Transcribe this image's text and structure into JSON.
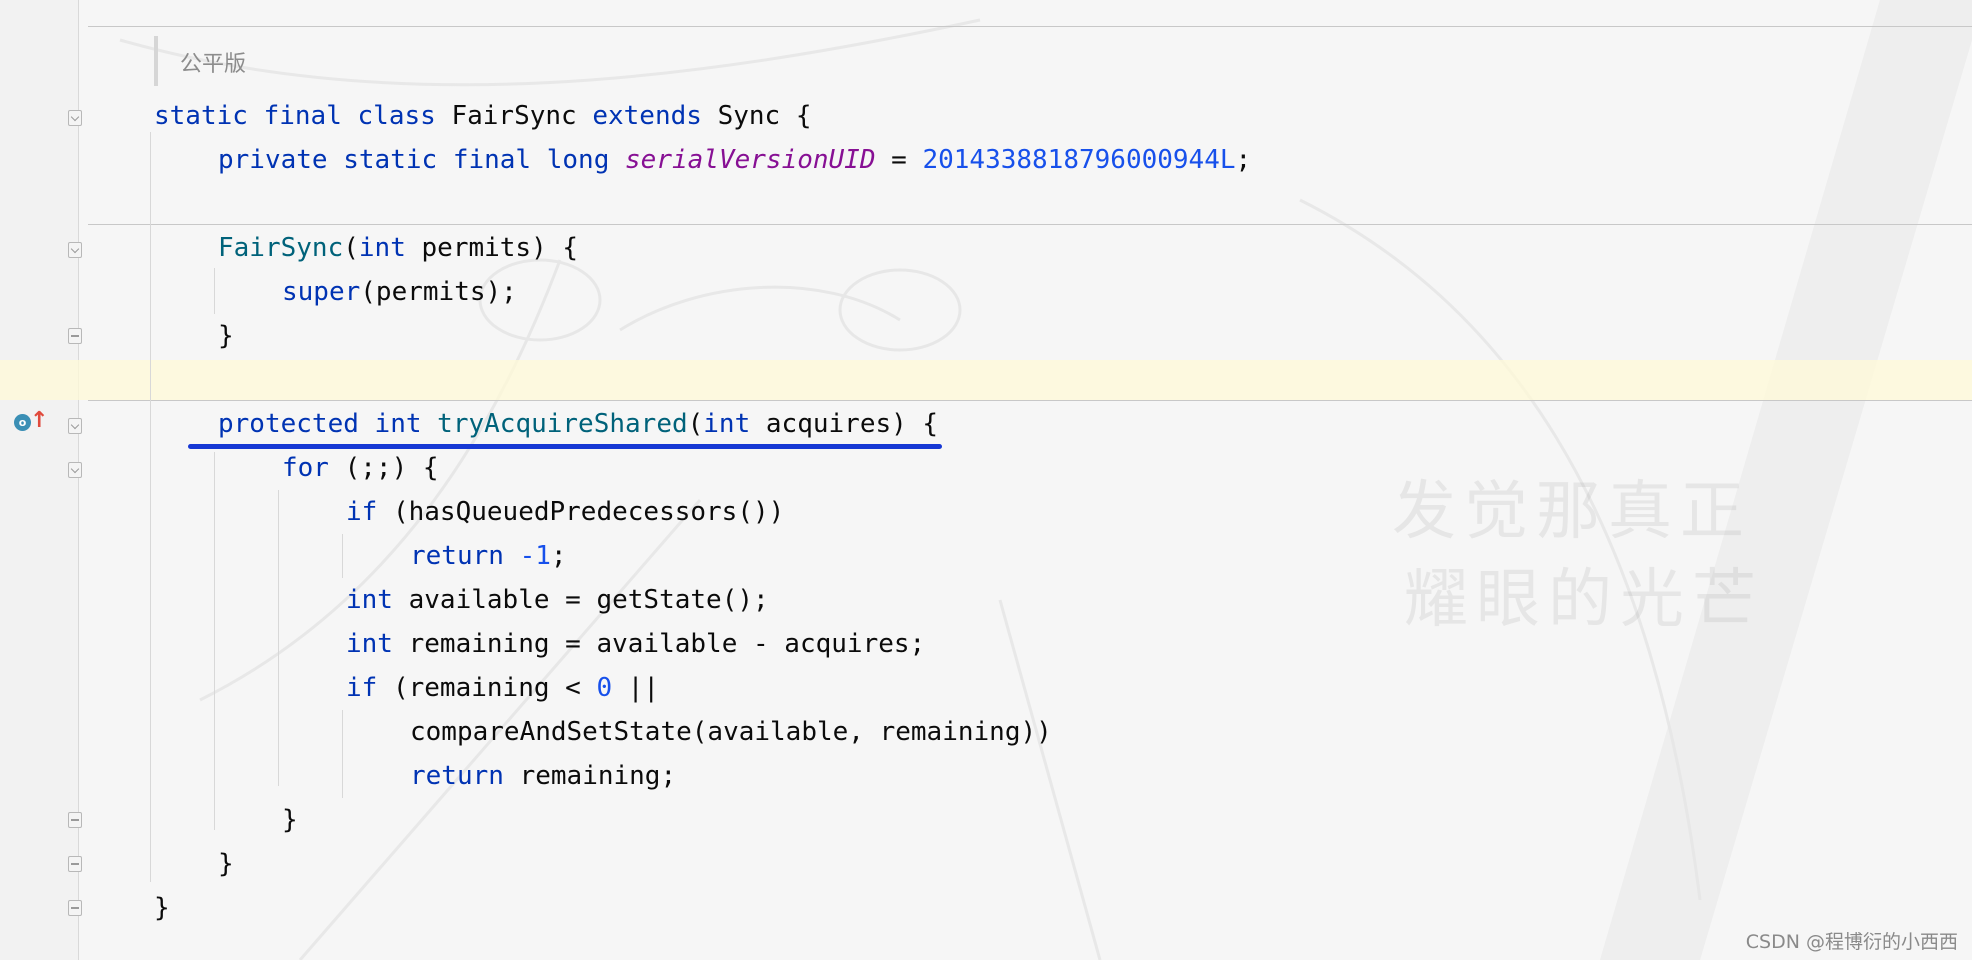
{
  "doc_comment": "公平版",
  "code": {
    "l1": {
      "k1": "static",
      "k2": "final",
      "k3": "class",
      "name": "FairSync",
      "k4": "extends",
      "parent": "Sync",
      "tail": " {"
    },
    "l2": {
      "k1": "private",
      "k2": "static",
      "k3": "final",
      "k4": "long",
      "field": "serialVersionUID",
      "eq": " = ",
      "num": "2014338818796000944L",
      "tail": ";"
    },
    "l3": {
      "ctor": "FairSync",
      "open": "(",
      "kw": "int",
      "rest": " permits) {"
    },
    "l4": {
      "kw": "super",
      "rest": "(permits);"
    },
    "l5": {
      "text": "}"
    },
    "l6": {
      "k1": "protected",
      "k2": "int",
      "fn": "tryAcquireShared",
      "open": "(",
      "kw": "int",
      "rest": " acquires) {"
    },
    "l7": {
      "kw": "for",
      "rest": " (;;) {"
    },
    "l8": {
      "kw": "if",
      "rest": " (hasQueuedPredecessors())"
    },
    "l9": {
      "kw": "return",
      "sp": " ",
      "num": "-1",
      "tail": ";"
    },
    "l10": {
      "kw": "int",
      "rest": " available = getState();"
    },
    "l11": {
      "kw": "int",
      "rest": " remaining = available - acquires;"
    },
    "l12": {
      "kw": "if",
      "rest": " (remaining < ",
      "num": "0",
      "tail": " ||"
    },
    "l13": {
      "text": "compareAndSetState(available, remaining))"
    },
    "l14": {
      "kw": "return",
      "rest": " remaining;"
    },
    "l15": {
      "text": "}"
    },
    "l16": {
      "text": "}"
    },
    "l17": {
      "text": "}"
    }
  },
  "watermark": {
    "line1": "发觉那真正",
    "line2": "耀眼的光芒"
  },
  "credit": "CSDN @程博衍的小西西",
  "colors": {
    "keyword": "#0033b3",
    "function": "#00627a",
    "field": "#871094",
    "number": "#1750eb",
    "underline": "#1638d4"
  },
  "icons": {
    "implements": "override-method-icon",
    "up_arrow": "implements-up-arrow-icon"
  }
}
